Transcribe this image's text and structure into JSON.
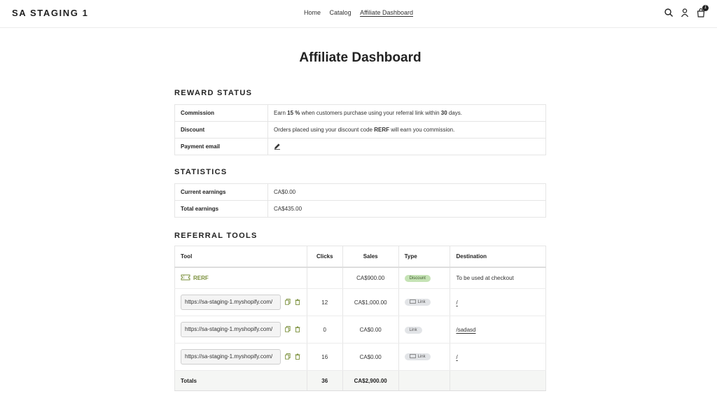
{
  "header": {
    "brand": "SA STAGING 1",
    "nav": [
      "Home",
      "Catalog",
      "Affiliate Dashboard"
    ],
    "cart_count": "1"
  },
  "page_title": "Affiliate Dashboard",
  "reward_status": {
    "heading": "REWARD STATUS",
    "commission_label": "Commission",
    "commission_pre": "Earn ",
    "commission_rate": "15 %",
    "commission_mid": " when customers purchase using your referral link within ",
    "commission_days": "30",
    "commission_post": " days.",
    "discount_label": "Discount",
    "discount_pre": "Orders placed using your discount code ",
    "discount_code": "RERF",
    "discount_post": " will earn you commission.",
    "payment_label": "Payment email"
  },
  "statistics": {
    "heading": "STATISTICS",
    "rows": [
      {
        "label": "Current earnings",
        "value": "CA$0.00"
      },
      {
        "label": "Total earnings",
        "value": "CA$435.00"
      }
    ]
  },
  "referral_tools": {
    "heading": "REFERRAL TOOLS",
    "columns": [
      "Tool",
      "Clicks",
      "Sales",
      "Type",
      "Destination"
    ],
    "code_row": {
      "code": "RERF",
      "clicks": "",
      "sales": "CA$900.00",
      "type": "Discount",
      "destination": "To be used at checkout"
    },
    "link_rows": [
      {
        "url": "https://sa-staging-1.myshopify.com/",
        "clicks": "12",
        "sales": "CA$1,000.00",
        "type": "Link",
        "destination": "/"
      },
      {
        "url": "https://sa-staging-1.myshopify.com/",
        "clicks": "0",
        "sales": "CA$0.00",
        "type": "Link",
        "destination": "/sadasd"
      },
      {
        "url": "https://sa-staging-1.myshopify.com/",
        "clicks": "16",
        "sales": "CA$0.00",
        "type": "Link",
        "destination": "/"
      }
    ],
    "totals": {
      "label": "Totals",
      "clicks": "36",
      "sales": "CA$2,900.00"
    }
  },
  "icons": [
    "search-icon",
    "account-icon",
    "cart-icon",
    "pencil-icon",
    "ticket-icon",
    "copy-icon",
    "trash-icon",
    "link-icon"
  ],
  "colors": {
    "code_green": "#7a8f3a",
    "discount_badge": "#c5e3b5",
    "link_badge": "#e2e4e7"
  }
}
